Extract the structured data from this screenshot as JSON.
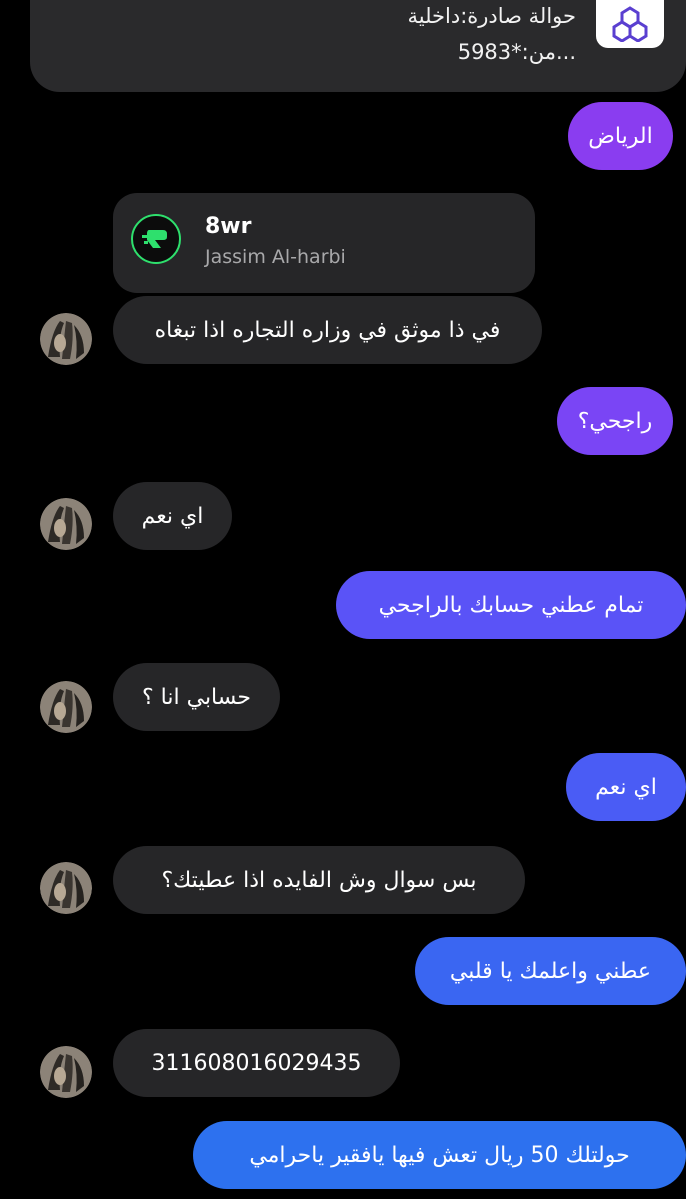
{
  "notification": {
    "line1": "حوالة صادرة:داخلية",
    "line2": "من:*5983...",
    "logo_icon": "bank-logo-icon"
  },
  "shared_profile": {
    "name": "8wr",
    "subtitle": "Jassim Al-harbi",
    "icon": "profile-logo-icon"
  },
  "messages": [
    {
      "side": "outgoing",
      "text": "الرياض",
      "color": "#8a3df0"
    },
    {
      "side": "incoming",
      "text": "في ذا موثق في وزاره التجاره اذا تبغاه"
    },
    {
      "side": "outgoing",
      "text": "راجحي؟",
      "color": "#7a45f5"
    },
    {
      "side": "incoming",
      "text": "اي نعم"
    },
    {
      "side": "outgoing",
      "text": "تمام عطني حسابك بالراجحي",
      "color": "#5a53f7"
    },
    {
      "side": "incoming",
      "text": "حسابي انا ؟"
    },
    {
      "side": "outgoing",
      "text": "اي نعم",
      "color": "#4a5cf5"
    },
    {
      "side": "incoming",
      "text": "بس سوال وش الفايده اذا عطيتك؟"
    },
    {
      "side": "outgoing",
      "text": "عطني واعلمك يا قلبي",
      "color": "#3a66f2"
    },
    {
      "side": "incoming",
      "text": "311608016029435"
    },
    {
      "side": "outgoing",
      "text": "حولتلك 50 ريال تعش فيها يافقير ياحرامي",
      "color": "#2d71ef"
    }
  ],
  "colors": {
    "background": "#000000",
    "incoming_bubble": "#262628",
    "card": "#2a2a2c",
    "accent_green": "#2ee06d"
  }
}
